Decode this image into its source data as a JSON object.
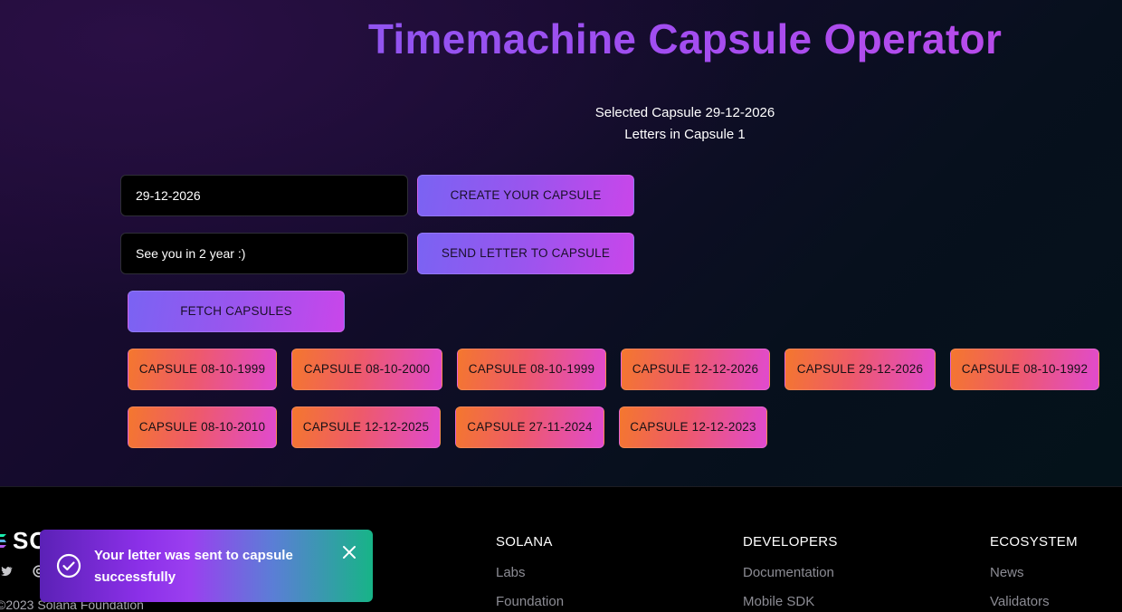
{
  "app": {
    "title": "Timemachine Capsule Operator",
    "selected_capsule_text": "Selected Capsule 29-12-2026",
    "letters_text": "Letters in Capsule 1"
  },
  "form": {
    "date_value": "29-12-2026",
    "letter_value": "See you in 2 year :)",
    "create_label": "CREATE YOUR CAPSULE",
    "send_label": "SEND LETTER TO CAPSULE",
    "fetch_label": "FETCH CAPSULES"
  },
  "capsules": [
    "CAPSULE 08-10-1999",
    "CAPSULE 08-10-2000",
    "CAPSULE 08-10-1999",
    "CAPSULE 12-12-2026",
    "CAPSULE 29-12-2026",
    "CAPSULE 08-10-1992",
    "CAPSULE 08-10-2010",
    "CAPSULE 12-12-2025",
    "CAPSULE 27-11-2024",
    "CAPSULE 12-12-2023"
  ],
  "footer": {
    "logo_text": "SO",
    "copyright": "©2023 Solana Foundation",
    "columns": [
      {
        "heading": "SOLANA",
        "links": [
          "Labs",
          "Foundation"
        ]
      },
      {
        "heading": "DEVELOPERS",
        "links": [
          "Documentation",
          "Mobile SDK"
        ]
      },
      {
        "heading": "ECOSYSTEM",
        "links": [
          "News",
          "Validators"
        ]
      }
    ],
    "social_icons": [
      "twitter-icon",
      "at-icon"
    ]
  },
  "toast": {
    "message": "Your letter was sent to capsule successfully",
    "icon": "check-circle-icon",
    "close_icon": "close-icon"
  },
  "colors": {
    "title_gradient": [
      "#7c5cf0",
      "#c04ae8"
    ],
    "primary_button": [
      "#7a63f3",
      "#c946ea"
    ],
    "capsule_button": [
      "#f4772e",
      "#e04ad0"
    ],
    "toast_gradient": [
      "#8b30e8",
      "#17b487"
    ]
  }
}
